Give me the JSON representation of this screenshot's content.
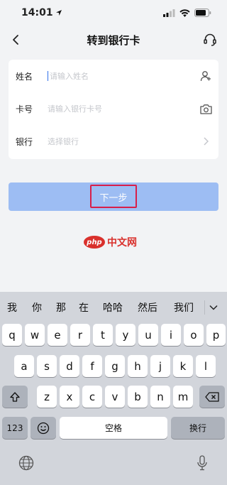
{
  "status_bar": {
    "time": "14:01"
  },
  "nav": {
    "title": "转到银行卡"
  },
  "form": {
    "name": {
      "label": "姓名",
      "placeholder": "请输入姓名"
    },
    "card": {
      "label": "卡号",
      "placeholder": "请输入银行卡号"
    },
    "bank": {
      "label": "银行",
      "placeholder": "选择银行"
    }
  },
  "next_button": {
    "label": "下一步"
  },
  "logo": {
    "badge": "php",
    "text": "中文网"
  },
  "keyboard": {
    "suggestions": [
      "我",
      "你",
      "那",
      "在",
      "哈哈",
      "然后",
      "我们"
    ],
    "row1": [
      "q",
      "w",
      "e",
      "r",
      "t",
      "y",
      "u",
      "i",
      "o",
      "p"
    ],
    "row2": [
      "a",
      "s",
      "d",
      "f",
      "g",
      "h",
      "j",
      "k",
      "l"
    ],
    "row3": [
      "z",
      "x",
      "c",
      "v",
      "b",
      "n",
      "m"
    ],
    "numbers_key": "123",
    "space_key": "空格",
    "return_key": "换行"
  },
  "colors": {
    "primary_button": "#9dbdf3",
    "highlight_box": "#d81e4a",
    "caret": "#2f6fea",
    "logo": "#d9302c"
  }
}
